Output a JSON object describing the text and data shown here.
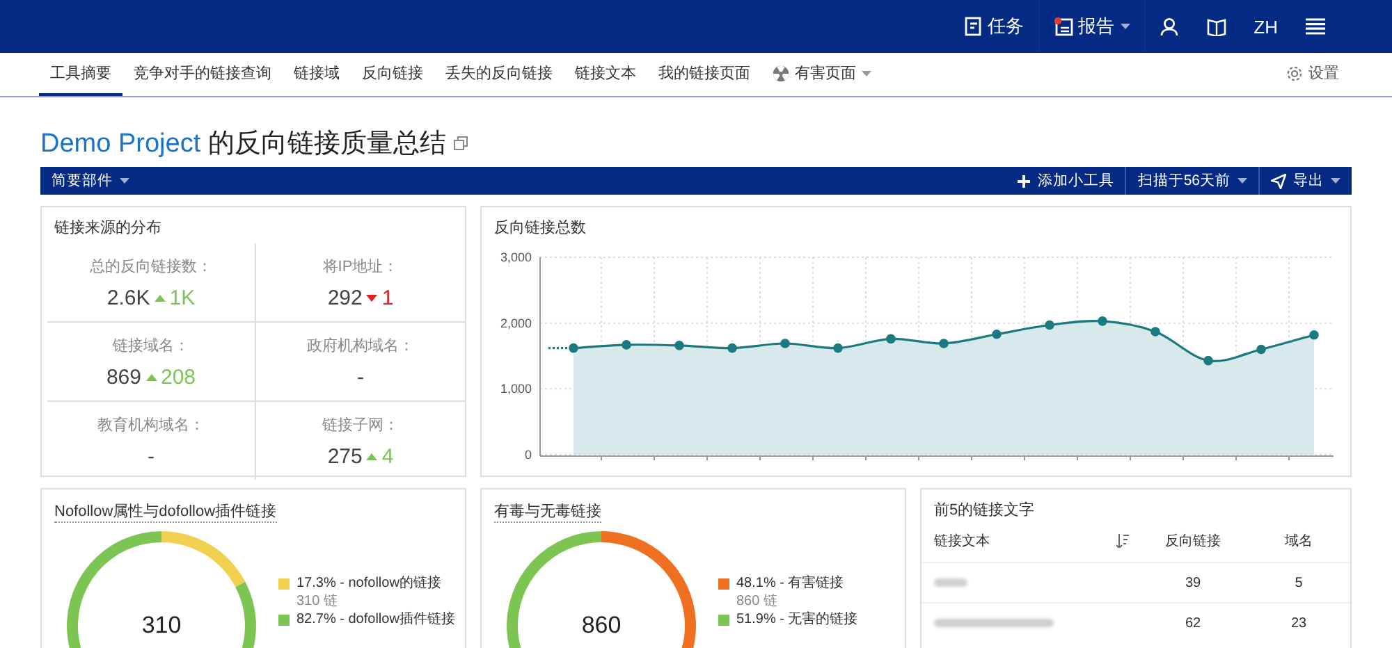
{
  "top_bar": {
    "items": [
      {
        "kind": "tasks",
        "label": "任务"
      },
      {
        "kind": "reports",
        "label": "报告"
      },
      {
        "kind": "user"
      },
      {
        "kind": "help"
      },
      {
        "kind": "language",
        "label": "ZH"
      },
      {
        "kind": "menu"
      }
    ]
  },
  "nav": {
    "tabs": [
      {
        "label": "工具摘要",
        "selected": true,
        "kind": "link"
      },
      {
        "label": "竞争对手的链接查询",
        "selected": false,
        "kind": "link"
      },
      {
        "label": "链接域",
        "selected": false,
        "kind": "link"
      },
      {
        "label": "反向链接",
        "selected": false,
        "kind": "link"
      },
      {
        "label": "丢失的反向链接",
        "selected": false,
        "kind": "link"
      },
      {
        "label": "链接文本",
        "selected": false,
        "kind": "link"
      },
      {
        "label": "我的链接页面",
        "selected": false,
        "kind": "link"
      },
      {
        "label": "有害页面",
        "selected": false,
        "kind": "dropdown"
      }
    ],
    "settings": "设置"
  },
  "title": {
    "project": "Demo Project",
    "text": "的反向链接质量总结"
  },
  "toolbar": {
    "widgets": "简要部件",
    "add": "添加小工具",
    "scan": "扫描于56天前",
    "export": "导出"
  },
  "distribution": {
    "title": "链接来源的分布",
    "stats": [
      {
        "label": "总的反向链接数：",
        "value": "2.6K",
        "rising": true,
        "delta": "1K"
      },
      {
        "label": "将IP地址：",
        "value": "292",
        "rising": false,
        "delta": "1"
      },
      {
        "label": "链接域名：",
        "value": "869",
        "rising": true,
        "delta": "208"
      },
      {
        "label": "政府机构域名：",
        "value": "-"
      },
      {
        "label": "教育机构域名：",
        "value": "-"
      },
      {
        "label": "链接子网：",
        "value": "275",
        "rising": true,
        "delta": "4"
      }
    ]
  },
  "backlinks_chart": {
    "title": "反向链接总数",
    "chart_data": {
      "type": "area",
      "ylim": [
        0,
        3000
      ],
      "yticks": [
        {
          "value": 0,
          "label": "0"
        },
        {
          "value": 1000,
          "label": "1,000"
        },
        {
          "value": 2000,
          "label": "2,000"
        },
        {
          "value": 3000,
          "label": "3,000"
        }
      ],
      "series": [
        {
          "color": "#1a7a80",
          "values": [
            1620,
            1670,
            1660,
            1620,
            1690,
            1620,
            1760,
            1690,
            1830,
            1970,
            2030,
            1870,
            1430,
            1600,
            1820
          ]
        }
      ]
    }
  },
  "nofollow": {
    "title": "Nofollow属性与dofollow插件链接",
    "center": "310",
    "legend": [
      {
        "text": "17.3% - nofollow的链接",
        "sub": "310 链",
        "color": "#f2d04f"
      },
      {
        "text": "82.7% - dofollow插件链接",
        "color": "#7cc552"
      }
    ],
    "chart_data": {
      "type": "donut",
      "values": [
        17.3,
        82.7
      ]
    }
  },
  "toxic": {
    "title": "有毒与无毒链接",
    "center": "860",
    "legend": [
      {
        "text": "48.1% - 有害链接",
        "sub": "860 链",
        "color": "#f07022"
      },
      {
        "text": "51.9% - 无害的链接",
        "color": "#7cc552"
      }
    ],
    "chart_data": {
      "type": "donut",
      "values": [
        48.1,
        51.9
      ]
    }
  },
  "top5": {
    "title": "前5的链接文字",
    "columns": [
      "链接文本",
      "反向链接",
      "域名"
    ],
    "rows": [
      {
        "backlinks": "39",
        "domains": "5"
      },
      {
        "backlinks": "62",
        "domains": "23"
      }
    ]
  }
}
